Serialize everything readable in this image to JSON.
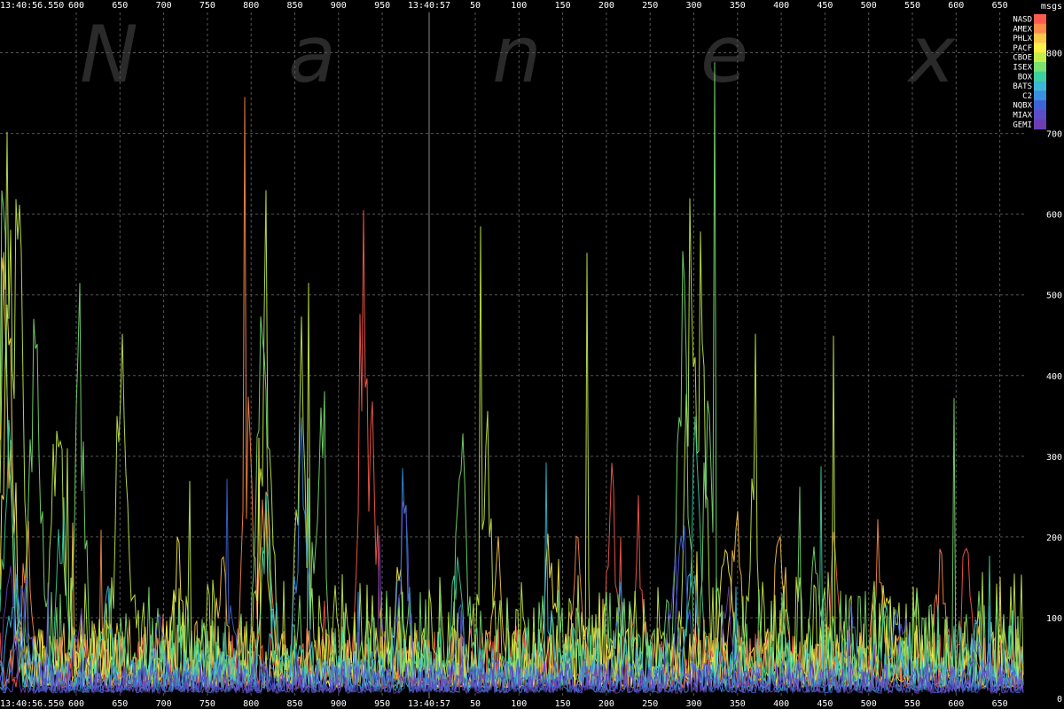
{
  "chart_data": {
    "type": "line",
    "title": "",
    "xlabel": "",
    "ylabel": "msgs",
    "watermark": [
      "N",
      "a",
      "n",
      "e",
      "x"
    ],
    "time_labels": [
      "13:40:56.550",
      "13:40:57"
    ],
    "x_ticks_first": [
      "600",
      "650",
      "700",
      "750",
      "800",
      "850",
      "900",
      "950"
    ],
    "x_ticks_second": [
      "50",
      "100",
      "150",
      "200",
      "250",
      "300",
      "350",
      "400",
      "450",
      "500",
      "550",
      "600",
      "650"
    ],
    "ylim": [
      0,
      850
    ],
    "y_ticks": [
      0,
      100,
      200,
      300,
      400,
      500,
      600,
      700,
      800
    ],
    "grid": true,
    "legend_position": "top-right",
    "colors": {
      "background": "#000000",
      "grid": "#555555",
      "midline": "#888888"
    },
    "series": [
      {
        "name": "NASD",
        "color": "#ff5a4f",
        "level": 55,
        "peaks": [
          [
            410,
            680
          ],
          [
            420,
            420
          ],
          [
            690,
            310
          ],
          [
            720,
            260
          ],
          [
            940,
            220
          ],
          [
            1090,
            270
          ]
        ]
      },
      {
        "name": "AMEX",
        "color": "#ff8c4a",
        "level": 50,
        "peaks": [
          [
            30,
            260
          ],
          [
            280,
            420
          ],
          [
            300,
            380
          ],
          [
            650,
            260
          ],
          [
            990,
            230
          ],
          [
            1060,
            210
          ]
        ]
      },
      {
        "name": "PHLX",
        "color": "#ffc84a",
        "level": 60,
        "peaks": [
          [
            5,
            730
          ],
          [
            250,
            220
          ],
          [
            300,
            260
          ],
          [
            560,
            240
          ],
          [
            830,
            320
          ],
          [
            880,
            290
          ]
        ]
      },
      {
        "name": "PACF",
        "color": "#ffef4a",
        "level": 55,
        "peaks": [
          [
            10,
            640
          ],
          [
            200,
            230
          ],
          [
            450,
            200
          ],
          [
            620,
            250
          ],
          [
            820,
            300
          ],
          [
            1000,
            200
          ]
        ]
      },
      {
        "name": "CBOE",
        "color": "#c6ee4a",
        "level": 95,
        "peaks": [
          [
            8,
            850
          ],
          [
            20,
            780
          ],
          [
            65,
            520
          ],
          [
            138,
            650
          ],
          [
            300,
            630
          ],
          [
            340,
            480
          ],
          [
            548,
            460
          ],
          [
            780,
            750
          ],
          [
            790,
            610
          ],
          [
            850,
            320
          ]
        ]
      },
      {
        "name": "ISEX",
        "color": "#7ae070",
        "level": 85,
        "peaks": [
          [
            5,
            820
          ],
          [
            40,
            600
          ],
          [
            90,
            520
          ],
          [
            295,
            600
          ],
          [
            360,
            460
          ],
          [
            520,
            390
          ],
          [
            770,
            700
          ],
          [
            800,
            520
          ],
          [
            920,
            240
          ]
        ]
      },
      {
        "name": "BOX",
        "color": "#3ecfa0",
        "level": 55,
        "peaks": [
          [
            10,
            420
          ],
          [
            70,
            300
          ],
          [
            300,
            270
          ],
          [
            515,
            230
          ],
          [
            785,
            380
          ],
          [
            1000,
            150
          ]
        ]
      },
      {
        "name": "BATS",
        "color": "#3cb8d6",
        "level": 38,
        "peaks": [
          [
            15,
            200
          ],
          [
            120,
            170
          ],
          [
            310,
            150
          ],
          [
            620,
            140
          ],
          [
            780,
            220
          ],
          [
            1100,
            120
          ]
        ]
      },
      {
        "name": "C2",
        "color": "#3c8ee0",
        "level": 30,
        "peaks": [
          [
            20,
            180
          ],
          [
            340,
            390
          ],
          [
            455,
            310
          ],
          [
            700,
            150
          ],
          [
            1010,
            130
          ]
        ]
      },
      {
        "name": "NQBX",
        "color": "#3f63d4",
        "level": 28,
        "peaks": [
          [
            25,
            170
          ],
          [
            260,
            140
          ],
          [
            520,
            130
          ],
          [
            770,
            280
          ],
          [
            960,
            130
          ]
        ]
      },
      {
        "name": "MIAX",
        "color": "#5a4fc8",
        "level": 30,
        "peaks": [
          [
            30,
            160
          ],
          [
            180,
            140
          ],
          [
            455,
            300
          ],
          [
            760,
            210
          ],
          [
            1020,
            140
          ]
        ]
      },
      {
        "name": "GEMI",
        "color": "#6b3fb3",
        "level": 26,
        "peaks": [
          [
            10,
            200
          ],
          [
            90,
            150
          ],
          [
            430,
            120
          ],
          [
            820,
            170
          ],
          [
            1100,
            110
          ]
        ]
      }
    ]
  }
}
